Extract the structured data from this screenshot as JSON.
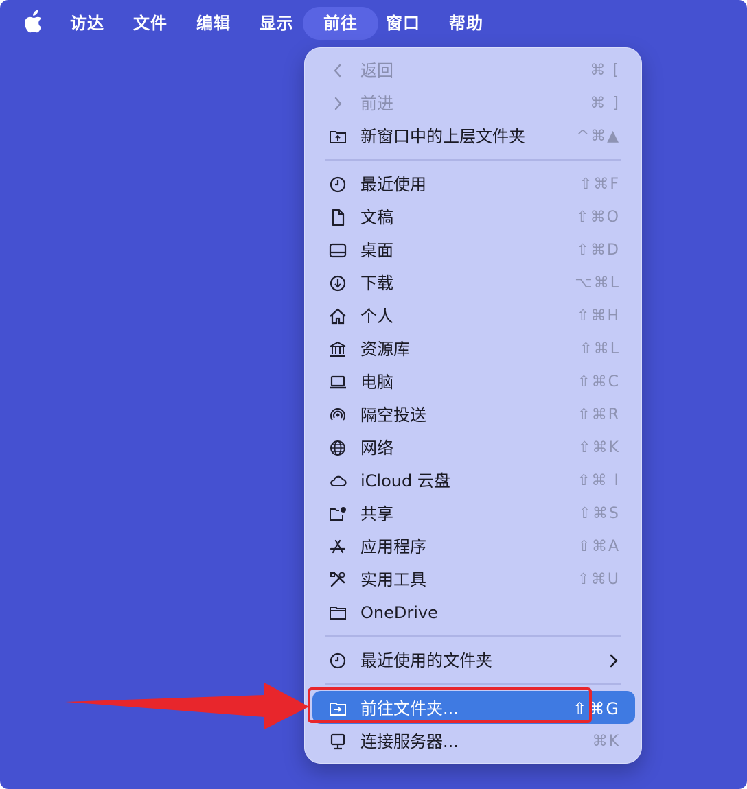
{
  "menubar": {
    "apple_icon": "apple-logo-icon",
    "items": [
      {
        "label": "访达"
      },
      {
        "label": "文件"
      },
      {
        "label": "编辑"
      },
      {
        "label": "显示"
      },
      {
        "label": "前往",
        "active": true
      },
      {
        "label": "窗口"
      },
      {
        "label": "帮助"
      }
    ]
  },
  "menu": {
    "items": [
      {
        "label": "返回",
        "shortcut": "⌘ [",
        "icon": "chevron-left-icon",
        "disabled": true
      },
      {
        "label": "前进",
        "shortcut": "⌘ ]",
        "icon": "chevron-right-icon",
        "disabled": true
      },
      {
        "label": "新窗口中的上层文件夹",
        "shortcut": "^⌘▲",
        "icon": "folder-up-icon"
      },
      {
        "label": "最近使用",
        "shortcut": "⇧⌘F",
        "icon": "clock-icon"
      },
      {
        "label": "文稿",
        "shortcut": "⇧⌘O",
        "icon": "document-icon"
      },
      {
        "label": "桌面",
        "shortcut": "⇧⌘D",
        "icon": "desktop-icon"
      },
      {
        "label": "下载",
        "shortcut": "⌥⌘L",
        "icon": "download-icon"
      },
      {
        "label": "个人",
        "shortcut": "⇧⌘H",
        "icon": "home-icon"
      },
      {
        "label": "资源库",
        "shortcut": "⇧⌘L",
        "icon": "library-icon"
      },
      {
        "label": "电脑",
        "shortcut": "⇧⌘C",
        "icon": "laptop-icon"
      },
      {
        "label": "隔空投送",
        "shortcut": "⇧⌘R",
        "icon": "airdrop-icon"
      },
      {
        "label": "网络",
        "shortcut": "⇧⌘K",
        "icon": "globe-icon"
      },
      {
        "label": "iCloud 云盘",
        "shortcut": "⇧⌘ I",
        "icon": "cloud-icon"
      },
      {
        "label": "共享",
        "shortcut": "⇧⌘S",
        "icon": "shared-folder-icon"
      },
      {
        "label": "应用程序",
        "shortcut": "⇧⌘A",
        "icon": "app-store-icon"
      },
      {
        "label": "实用工具",
        "shortcut": "⇧⌘U",
        "icon": "tools-icon"
      },
      {
        "label": "OneDrive",
        "shortcut": "",
        "icon": "folder-icon"
      },
      {
        "label": "最近使用的文件夹",
        "shortcut": "",
        "icon": "clock-icon",
        "submenu": true
      },
      {
        "label": "前往文件夹...",
        "shortcut": "⇧⌘G",
        "icon": "folder-arrow-icon",
        "highlighted": true
      },
      {
        "label": "连接服务器...",
        "shortcut": "⌘K",
        "icon": "server-icon"
      }
    ]
  },
  "annotation": {
    "highlight_color": "#e8262c",
    "accent": "#3f7ae2",
    "background": "#4551d1"
  }
}
